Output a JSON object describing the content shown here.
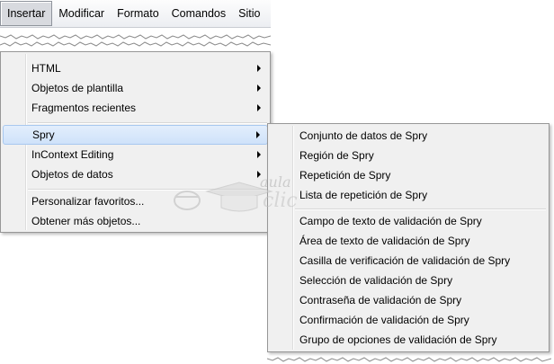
{
  "menubar": {
    "items": [
      "Insertar",
      "Modificar",
      "Formato",
      "Comandos",
      "Sitio"
    ]
  },
  "dropdown": {
    "items": [
      {
        "label": "HTML",
        "submenu": true
      },
      {
        "label": "Objetos de plantilla",
        "submenu": true
      },
      {
        "label": "Fragmentos recientes",
        "submenu": true
      },
      {
        "label": "Spry",
        "submenu": true
      },
      {
        "label": "InContext Editing",
        "submenu": true
      },
      {
        "label": "Objetos de datos",
        "submenu": true
      },
      {
        "label": "Personalizar favoritos...",
        "submenu": false
      },
      {
        "label": "Obtener más objetos...",
        "submenu": false
      }
    ]
  },
  "submenu": {
    "items": [
      "Conjunto de datos de Spry",
      "Región de Spry",
      "Repetición de Spry",
      "Lista de repetición de Spry",
      "Campo de texto de validación de Spry",
      "Área de texto de validación de Spry",
      "Casilla de verificación de validación de Spry",
      "Selección de validación de Spry",
      "Contraseña de validación de Spry",
      "Confirmación de validación de Spry",
      "Grupo de opciones de validación de Spry"
    ]
  },
  "watermark": {
    "text_top": "aula",
    "text_bottom": "clic"
  },
  "colors": {
    "highlight": "#cfe2fa",
    "highlight_border": "#a8c8ef",
    "menu_bg": "#f0f0f0"
  }
}
